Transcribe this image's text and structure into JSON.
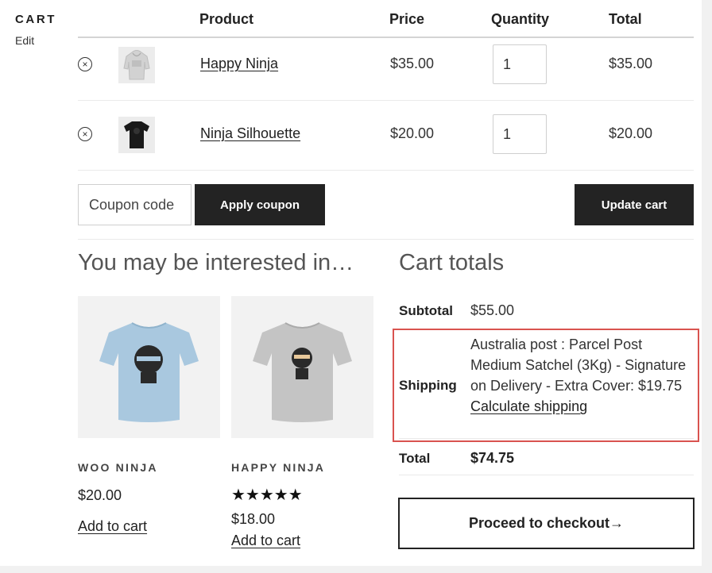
{
  "sidebar": {
    "title": "CART",
    "edit_label": "Edit"
  },
  "table": {
    "headers": {
      "product": "Product",
      "price": "Price",
      "quantity": "Quantity",
      "total": "Total"
    },
    "rows": [
      {
        "remove": "×",
        "name": "Happy Ninja",
        "price": "$35.00",
        "quantity": "1",
        "total": "$35.00",
        "image": "hoodie-grey"
      },
      {
        "remove": "×",
        "name": "Ninja Silhouette",
        "price": "$20.00",
        "quantity": "1",
        "total": "$20.00",
        "image": "tshirt-black"
      }
    ]
  },
  "actions": {
    "coupon_placeholder": "Coupon code",
    "apply_coupon": "Apply coupon",
    "update_cart": "Update cart"
  },
  "cross_sells": {
    "heading": "You may be interested in…",
    "products": [
      {
        "name": "WOO NINJA",
        "price": "$20.00",
        "add_to_cart": "Add to cart",
        "image": "tshirt-blue"
      },
      {
        "name": "HAPPY NINJA",
        "price": "$18.00",
        "rating": 5,
        "stars": "★★★★★",
        "add_to_cart": "Add to cart",
        "image": "tshirt-grey"
      }
    ]
  },
  "totals": {
    "heading": "Cart totals",
    "subtotal_label": "Subtotal",
    "subtotal_value": "$55.00",
    "shipping_label": "Shipping",
    "shipping_method": "Australia post : Parcel Post Medium Satchel (3Kg) - Signature on Delivery - Extra Cover: $19.75",
    "calculate_shipping": "Calculate shipping",
    "total_label": "Total",
    "total_value": "$74.75",
    "checkout": "Proceed to checkout→"
  },
  "colors": {
    "button_dark": "#232323",
    "highlight": "#d9534f",
    "text": "#333333"
  }
}
